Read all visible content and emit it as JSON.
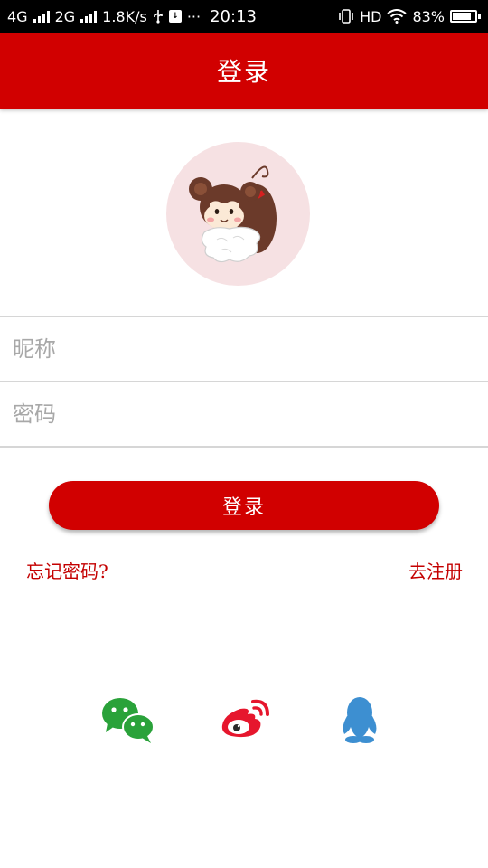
{
  "status_bar": {
    "network1": "4G",
    "network2": "2G",
    "speed": "1.8K/s",
    "dots": "···",
    "time": "20:13",
    "hd": "HD",
    "battery": "83%",
    "battery_level": 0.83,
    "icons": [
      "signal-icon",
      "usb-icon",
      "notification-icon",
      "vibrate-icon",
      "wifi-icon",
      "battery-icon"
    ]
  },
  "header": {
    "title": "登录"
  },
  "avatar": {
    "icon": "monkey-avatar-icon",
    "background": "#f6e1e3"
  },
  "form": {
    "nickname_placeholder": "昵称",
    "nickname_value": "",
    "password_placeholder": "密码",
    "password_value": ""
  },
  "actions": {
    "login_label": "登录",
    "forgot_label": "忘记密码?",
    "register_label": "去注册"
  },
  "social": {
    "items": [
      "wechat-icon",
      "weibo-icon",
      "qq-icon"
    ]
  },
  "colors": {
    "primary": "#d10000",
    "link": "#c40000",
    "wechat": "#2aa23a",
    "weibo": "#e6162d",
    "qq": "#3d8fd1"
  }
}
